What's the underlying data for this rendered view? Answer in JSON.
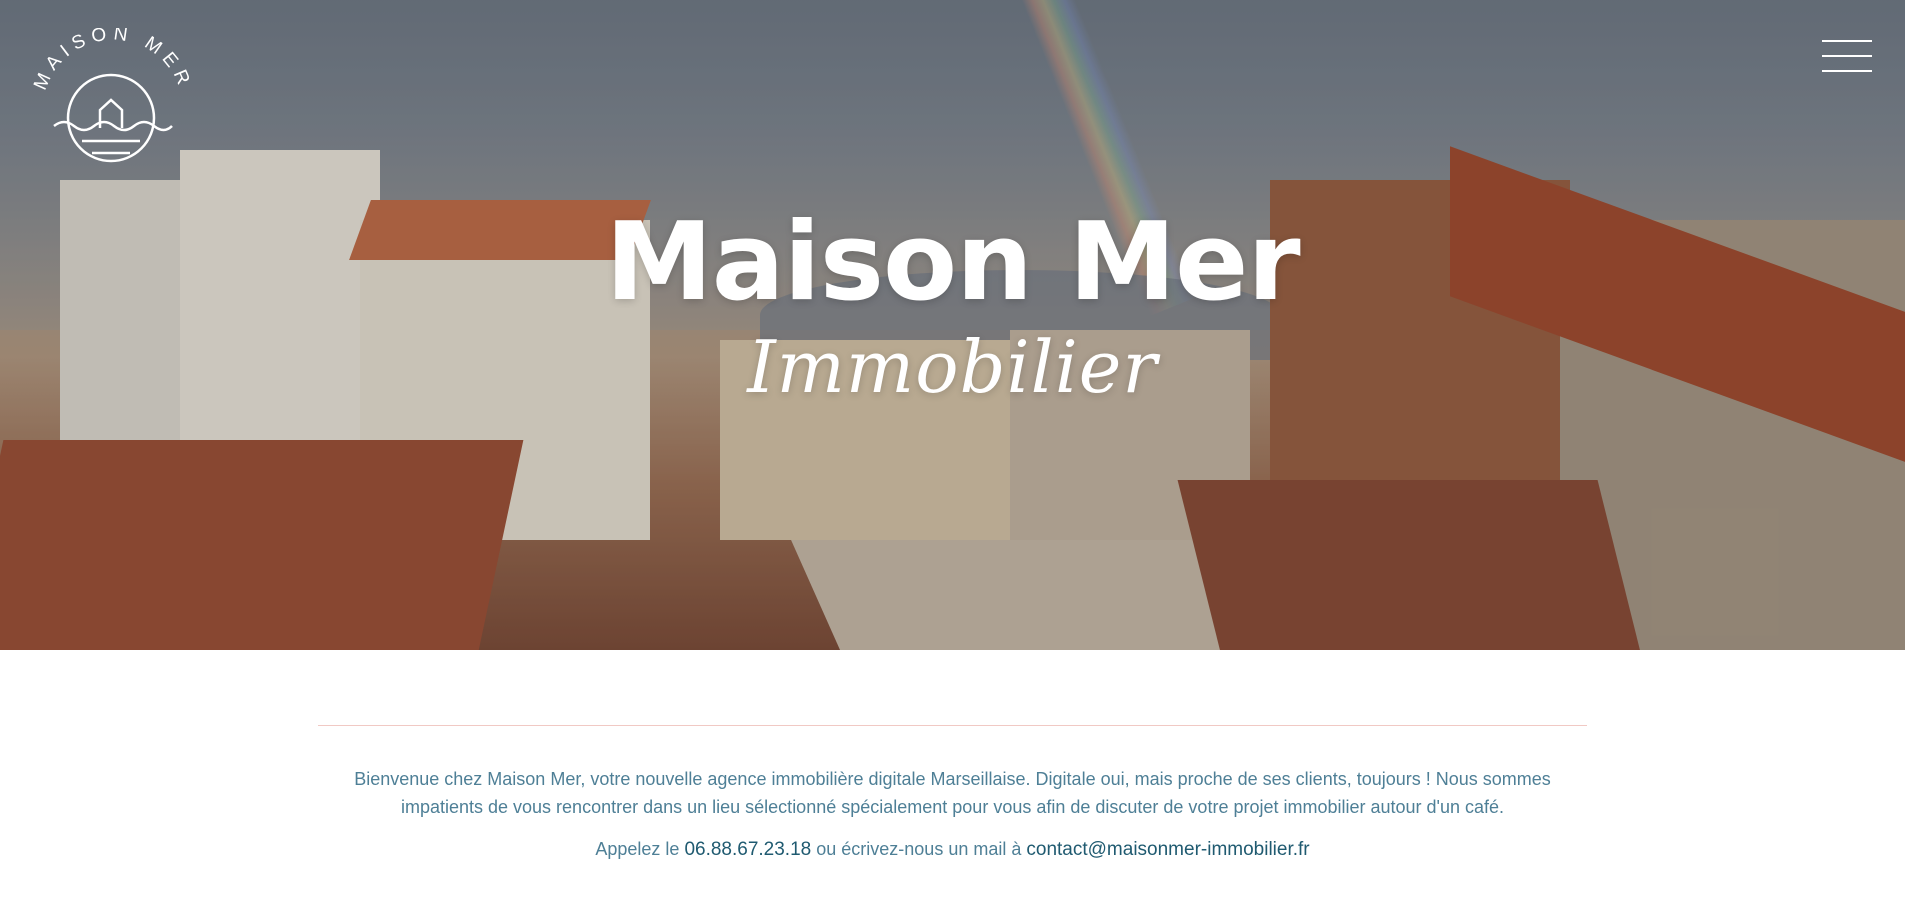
{
  "brand": {
    "logo_text": "MAISON MER",
    "title": "Maison Mer",
    "subtitle": "Immobilier"
  },
  "header": {
    "menu_icon": "hamburger-menu-icon"
  },
  "intro": {
    "paragraph": "Bienvenue chez Maison Mer, votre nouvelle agence immobilière digitale Marseillaise. Digitale oui, mais proche de ses clients, toujours ! Nous sommes impatients de vous rencontrer dans un lieu sélectionné spécialement pour vous afin de discuter de votre projet immobilier autour d'un café."
  },
  "contact": {
    "call_prefix": "Appelez le",
    "phone": "06.88.67.23.18",
    "mail_prefix": "ou écrivez-nous un mail à",
    "email": "contact@maisonmer-immobilier.fr"
  },
  "colors": {
    "text_primary": "#4e7f96",
    "text_strong": "#1f5a70",
    "divider": "#f1c9c4"
  }
}
